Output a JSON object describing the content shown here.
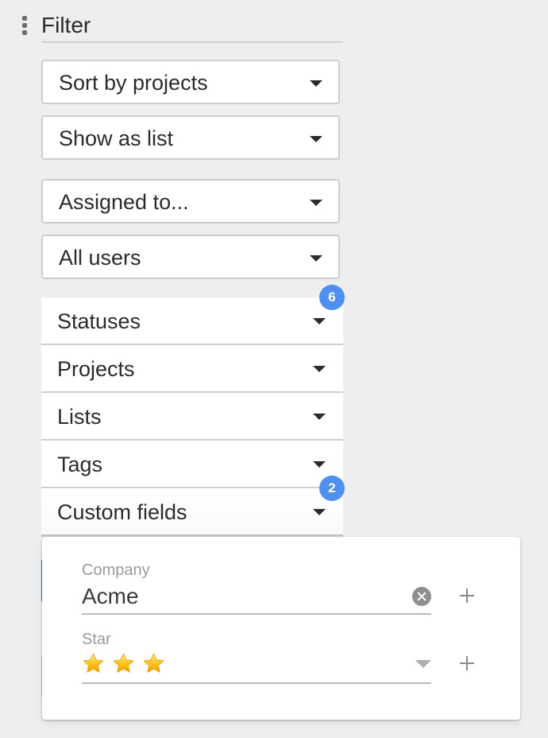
{
  "header": {
    "title": "Filter"
  },
  "selects": {
    "sort": "Sort by projects",
    "view": "Show as list",
    "assignment": "Assigned to...",
    "users": "All users"
  },
  "filters": [
    {
      "label": "Statuses",
      "badge": "6"
    },
    {
      "label": "Projects",
      "badge": null
    },
    {
      "label": "Lists",
      "badge": null
    },
    {
      "label": "Tags",
      "badge": null
    },
    {
      "label": "Custom fields",
      "badge": "2"
    }
  ],
  "custom_fields_popover": {
    "fields": [
      {
        "label": "Company",
        "value": "Acme",
        "action_icon": "clear-icon"
      },
      {
        "label": "Star",
        "value_stars": 3,
        "action_icon": "dropdown-icon"
      }
    ]
  },
  "colors": {
    "badge": "#4f8fef",
    "accent": "#3b6fd4",
    "background": "#edeef0"
  }
}
